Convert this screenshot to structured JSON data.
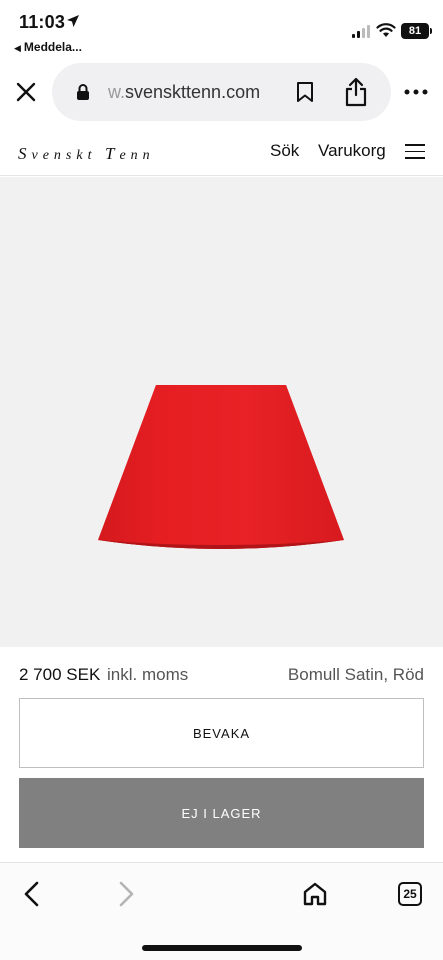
{
  "status_bar": {
    "time": "11:03",
    "back_app": "Meddela...",
    "battery": "81"
  },
  "browser": {
    "url_faded": "w.",
    "url_domain": "svenskttenn.com",
    "open_tabs": "25"
  },
  "site": {
    "logo_first": "S",
    "logo_rest_1": "venskt",
    "logo_second": "T",
    "logo_rest_2": "enn",
    "nav_search": "Sök",
    "nav_cart": "Varukorg"
  },
  "product": {
    "price": "2 700 SEK",
    "vat_note": "inkl. moms",
    "variant": "Bomull Satin, Röd",
    "watch_label": "BEVAKA",
    "stock_label": "EJ I LAGER",
    "shade_color": "#e51e22"
  },
  "icons": {
    "close": "close-icon",
    "lock": "lock-icon",
    "bookmark": "bookmark-icon",
    "share": "share-icon",
    "more": "more-icon",
    "menu": "hamburger-icon",
    "back": "chevron-left-icon",
    "forward": "chevron-right-icon",
    "home": "home-icon",
    "tabs": "tabs-icon"
  }
}
